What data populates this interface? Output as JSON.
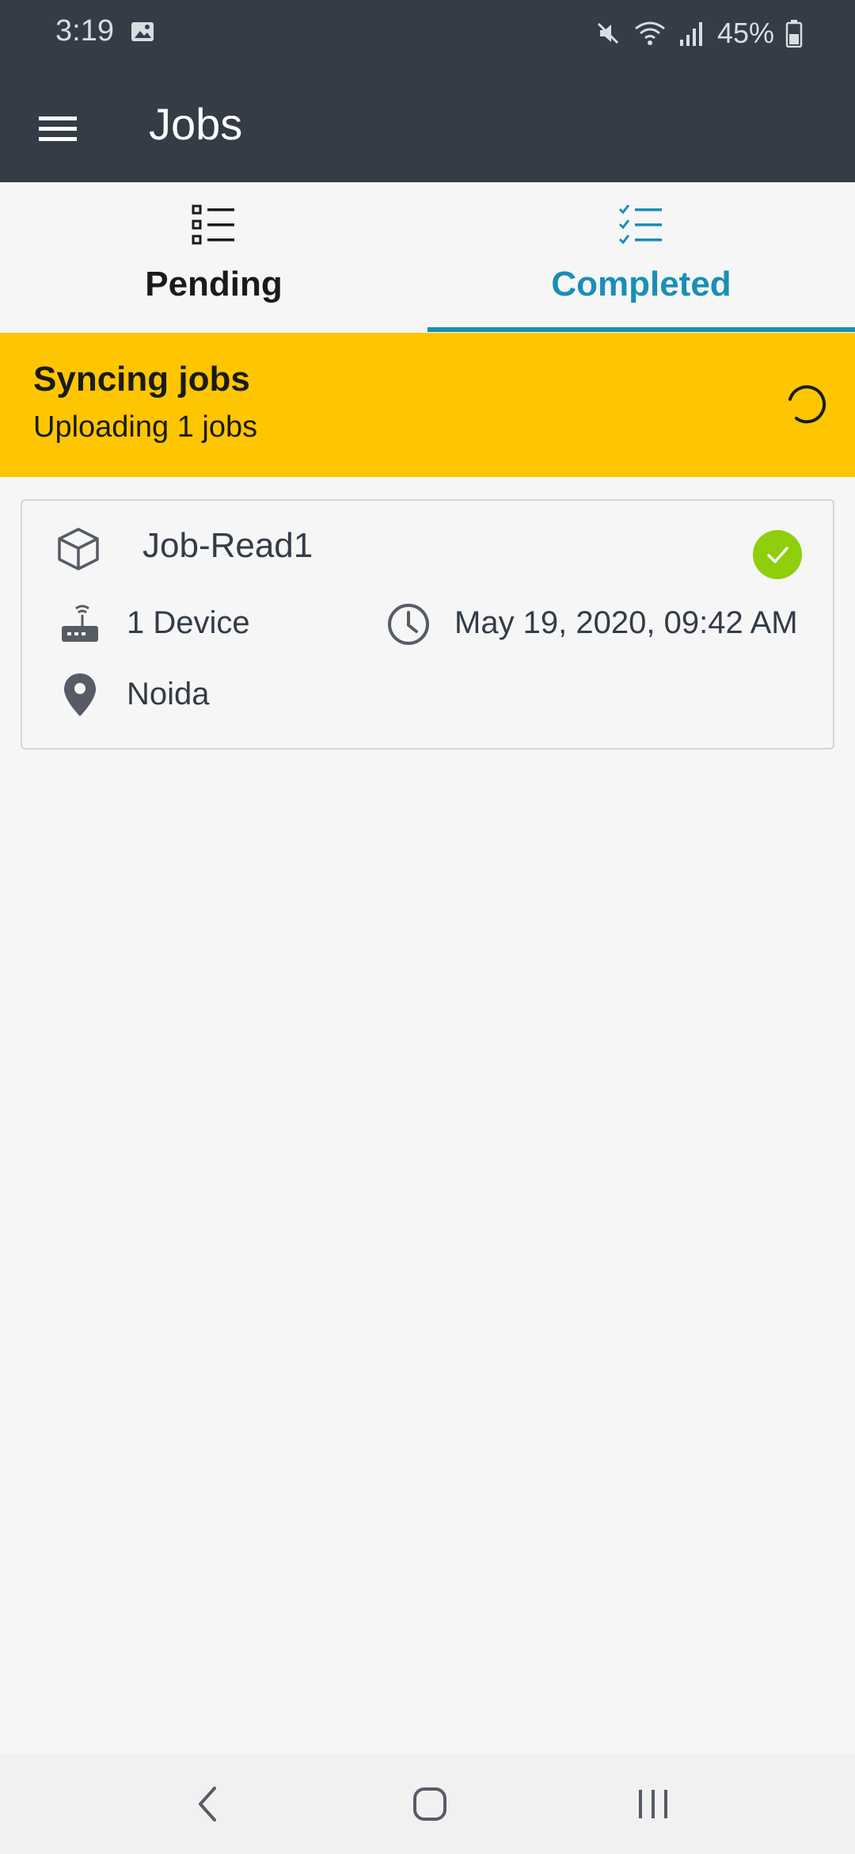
{
  "status_bar": {
    "time": "3:19",
    "battery": "45%",
    "icons": [
      "gallery-icon",
      "mute-icon",
      "wifi-icon",
      "signal-icon",
      "battery-icon"
    ]
  },
  "app_bar": {
    "title": "Jobs",
    "menu_icon": "hamburger-menu-icon",
    "background": "#333c47"
  },
  "tabs": [
    {
      "label": "Pending",
      "icon": "list-icon",
      "selected": false
    },
    {
      "label": "Completed",
      "icon": "checklist-icon",
      "selected": true
    }
  ],
  "sync_banner": {
    "title": "Syncing jobs",
    "subtitle": "Uploading 1 jobs",
    "background": "#fec601",
    "icon": "loading-spinner-icon"
  },
  "jobs": [
    {
      "name": "Job-Read1",
      "devices": "1 Device",
      "datetime": "May 19, 2020, 09:42 AM",
      "location": "Noida",
      "status": "completed",
      "status_color": "#8fce0a"
    }
  ],
  "colors": {
    "accent": "#1a8fb5",
    "text": "#333c47"
  },
  "nav_bar": {
    "buttons": [
      "back-icon",
      "home-icon",
      "recents-icon"
    ]
  }
}
